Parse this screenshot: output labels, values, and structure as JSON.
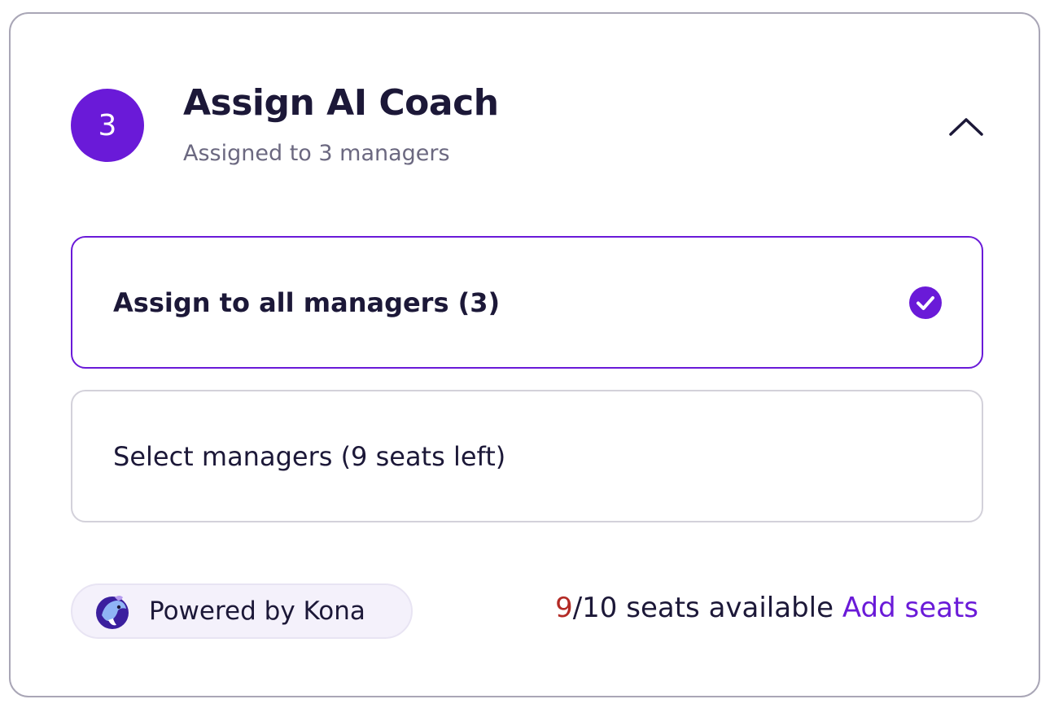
{
  "header": {
    "step_number": "3",
    "title": "Assign AI Coach",
    "subtitle": "Assigned to 3 managers",
    "collapse_icon": "chevron-up-icon"
  },
  "options": [
    {
      "label": "Assign to all managers (3)",
      "selected": true,
      "icon": "check-circle-icon"
    },
    {
      "label": "Select managers (9 seats left)",
      "selected": false
    }
  ],
  "footer": {
    "powered_by": "Powered by Kona",
    "logo_icon": "kona-logo-icon",
    "seats_available_count": "9",
    "seats_total_text": "/10 seats available",
    "add_seats_label": "Add seats"
  },
  "colors": {
    "accent": "#6a1ad8",
    "available_count": "#b32a25",
    "border": "#a9a6b6",
    "text": "#1c1838",
    "muted_text": "#6b6880"
  }
}
